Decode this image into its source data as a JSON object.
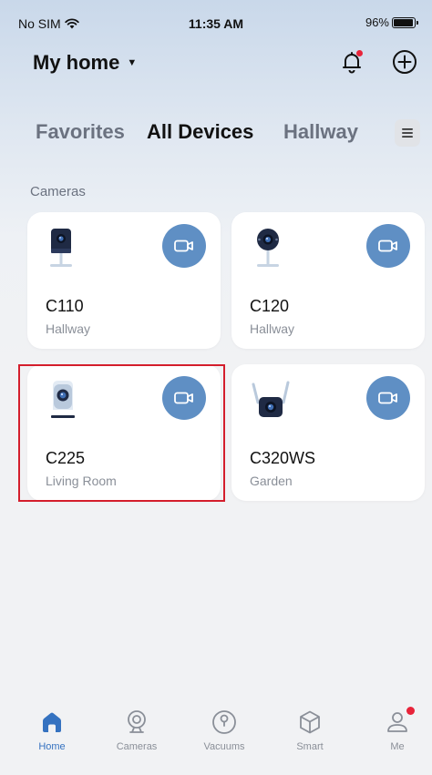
{
  "status_bar": {
    "carrier": "No SIM",
    "time": "11:35 AM",
    "battery": "96%",
    "battery_level": 0.96
  },
  "header": {
    "home_title": "My home",
    "icons": [
      "caret-down-icon",
      "bell-icon",
      "add-circle-icon"
    ]
  },
  "tabs": [
    {
      "label": "Favorites",
      "active": false
    },
    {
      "label": "All Devices",
      "active": true
    },
    {
      "label": "Hallway",
      "active": false
    }
  ],
  "section": {
    "label": "Cameras"
  },
  "devices": [
    {
      "name": "C110",
      "room": "Hallway",
      "icon": "camera-c110-icon"
    },
    {
      "name": "C120",
      "room": "Hallway",
      "icon": "camera-c120-icon"
    },
    {
      "name": "C225",
      "room": "Living Room",
      "icon": "camera-c225-icon",
      "highlighted": true
    },
    {
      "name": "C320WS",
      "room": "Garden",
      "icon": "camera-c320ws-icon"
    }
  ],
  "nav": [
    {
      "label": "Home",
      "icon": "home-icon",
      "active": true
    },
    {
      "label": "Cameras",
      "icon": "cameras-icon",
      "active": false
    },
    {
      "label": "Vacuums",
      "icon": "vacuums-icon",
      "active": false
    },
    {
      "label": "Smart",
      "icon": "smart-icon",
      "active": false
    },
    {
      "label": "Me",
      "icon": "me-icon",
      "active": false,
      "badge": true
    }
  ],
  "colors": {
    "accent": "#3572c0",
    "video_button": "#5f8fc4",
    "badge": "#e8243a",
    "highlight": "#d41e2c"
  }
}
